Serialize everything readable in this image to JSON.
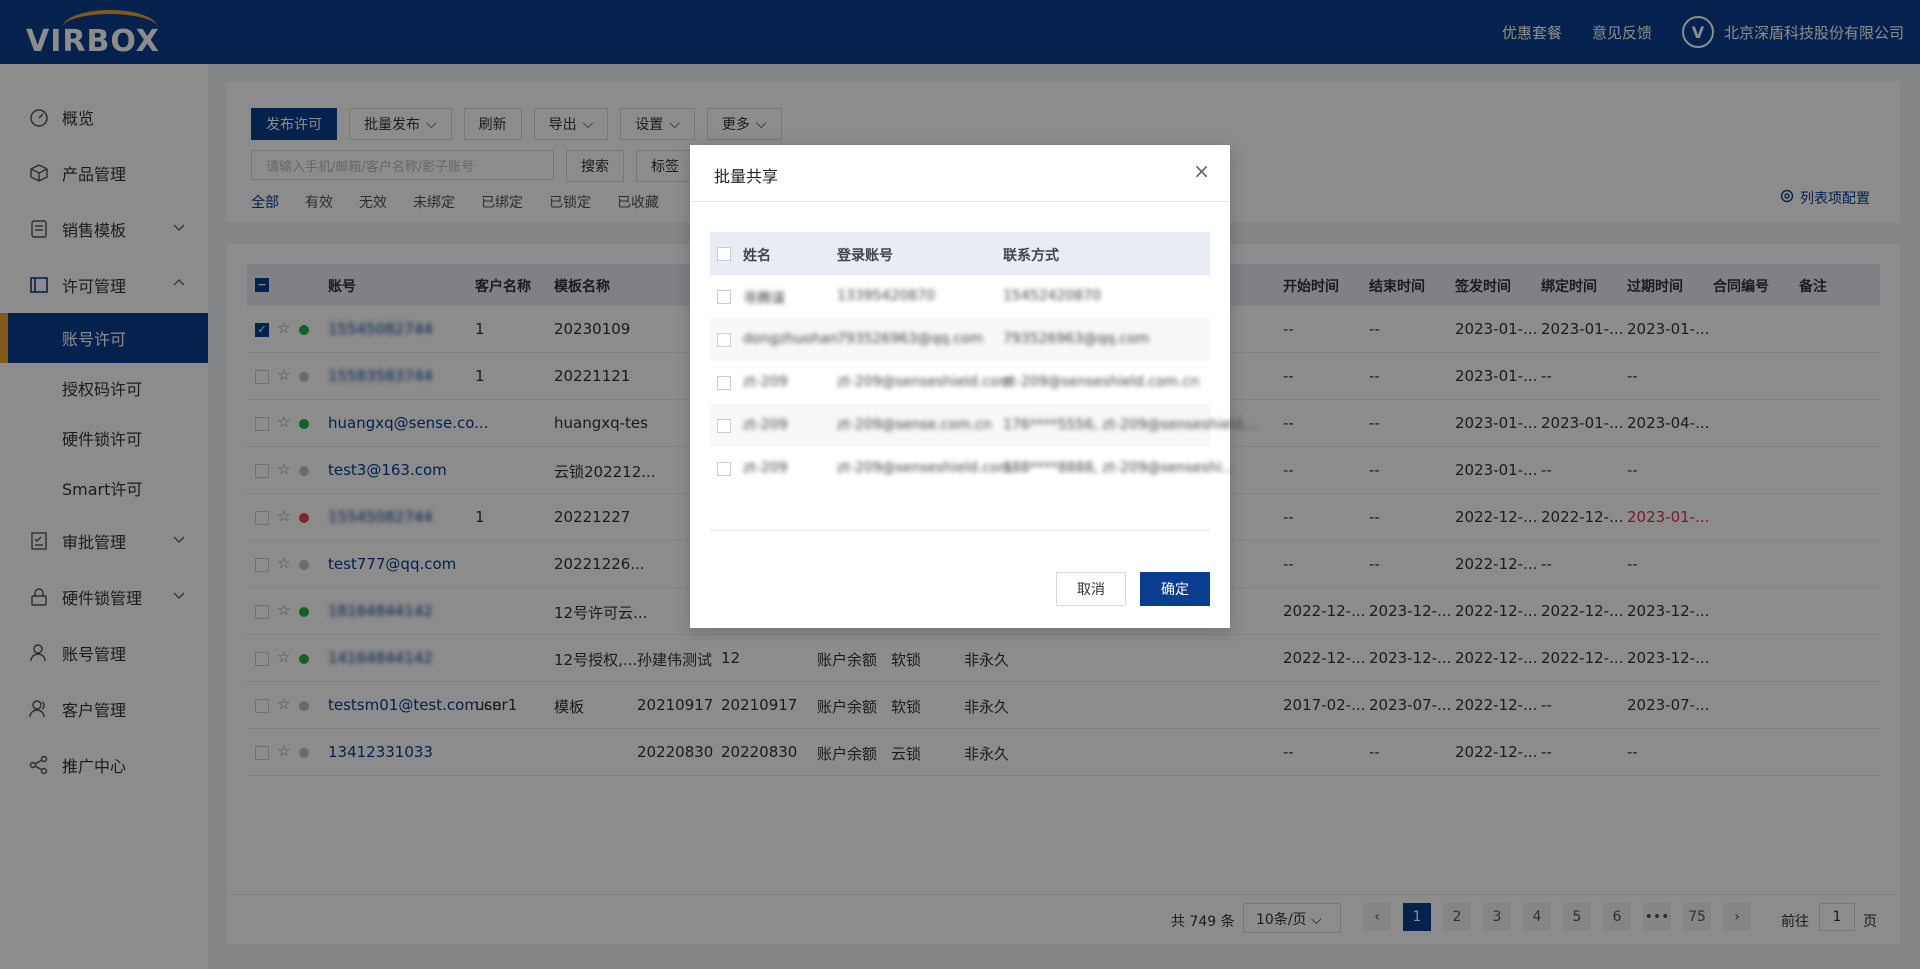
{
  "header": {
    "logo_text": "VIRBOX",
    "links": [
      "优惠套餐",
      "意见反馈"
    ],
    "company": "北京深盾科技股份有限公司"
  },
  "sidebar": {
    "items": [
      {
        "label": "概览",
        "icon": "dashboard-icon"
      },
      {
        "label": "产品管理",
        "icon": "cube-icon"
      },
      {
        "label": "销售模板",
        "icon": "template-icon",
        "chevron": "down"
      },
      {
        "label": "许可管理",
        "icon": "license-icon",
        "chevron": "up"
      },
      {
        "label": "审批管理",
        "icon": "approval-icon",
        "chevron": "down"
      },
      {
        "label": "硬件锁管理",
        "icon": "lock-icon",
        "chevron": "down"
      },
      {
        "label": "账号管理",
        "icon": "user-icon"
      },
      {
        "label": "客户管理",
        "icon": "users-icon"
      },
      {
        "label": "推广中心",
        "icon": "share-icon"
      }
    ],
    "license_sub": [
      "账号许可",
      "授权码许可",
      "硬件锁许可",
      "Smart许可"
    ],
    "active_sub": "账号许可"
  },
  "toolbar": {
    "publish": "发布许可",
    "batch_publish": "批量发布",
    "refresh": "刷新",
    "export": "导出",
    "settings": "设置",
    "more": "更多",
    "search_placeholder": "请输入手机/邮箱/客户名称/影子账号",
    "search_btn": "搜索",
    "tag_btn": "标签",
    "filters": [
      "全部",
      "有效",
      "无效",
      "未绑定",
      "已绑定",
      "已锁定",
      "已收藏"
    ],
    "column_config": "列表项配置"
  },
  "table": {
    "headers": [
      "账号",
      "客户名称",
      "模板名称",
      "开始时间",
      "结束时间",
      "签发时间",
      "绑定时间",
      "过期时间",
      "合同编号",
      "备注"
    ],
    "rows": [
      {
        "account": "15545082744",
        "blur": true,
        "checked": true,
        "status": "green",
        "customer": "1",
        "template": "20230109",
        "c4": "",
        "c5": "",
        "c6": "",
        "c7": "",
        "c8": "",
        "start": "--",
        "end": "--",
        "issue": "2023-01-...",
        "bind": "2023-01-...",
        "expire": "2023-01-..."
      },
      {
        "account": "15583583744",
        "blur": true,
        "checked": false,
        "status": "gray",
        "customer": "1",
        "template": "20221121",
        "c4": "",
        "c5": "",
        "c6": "",
        "c7": "",
        "c8": "",
        "start": "--",
        "end": "--",
        "issue": "2023-01-...",
        "bind": "--",
        "expire": "--"
      },
      {
        "account": "huangxq@sense.co...",
        "blur": false,
        "checked": false,
        "status": "green",
        "customer": "",
        "template": "huangxq-tes",
        "c4": "",
        "c5": "",
        "c6": "",
        "c7": "",
        "c8": "",
        "start": "--",
        "end": "--",
        "issue": "2023-01-...",
        "bind": "2023-01-...",
        "expire": "2023-04-..."
      },
      {
        "account": "test3@163.com",
        "blur": false,
        "checked": false,
        "status": "gray",
        "customer": "",
        "template": "云锁202212...",
        "c4": "",
        "c5": "",
        "c6": "",
        "c7": "",
        "c8": "",
        "start": "--",
        "end": "--",
        "issue": "2023-01-...",
        "bind": "--",
        "expire": "--"
      },
      {
        "account": "15545082744",
        "blur": true,
        "checked": false,
        "status": "red",
        "customer": "1",
        "template": "20221227",
        "c4": "",
        "c5": "",
        "c6": "",
        "c7": "",
        "c8": "",
        "start": "--",
        "end": "--",
        "issue": "2022-12-...",
        "bind": "2022-12-...",
        "expire": "2023-01-...",
        "expire_red": true
      },
      {
        "account": "test777@qq.com",
        "blur": false,
        "checked": false,
        "status": "gray",
        "customer": "",
        "template": "20221226...",
        "c4": "",
        "c5": "",
        "c6": "",
        "c7": "",
        "c8": "",
        "start": "--",
        "end": "--",
        "issue": "2022-12-...",
        "bind": "--",
        "expire": "--"
      },
      {
        "account": "18164844142",
        "blur": true,
        "checked": false,
        "status": "green",
        "customer": "",
        "template": "12号许可云...",
        "c4": "",
        "c5": "",
        "c6": "",
        "c7": "",
        "c8": "",
        "start": "2022-12-...",
        "end": "2023-12-...",
        "issue": "2022-12-...",
        "bind": "2022-12-...",
        "expire": "2023-12-..."
      },
      {
        "account": "14164844142",
        "blur": true,
        "checked": false,
        "status": "green",
        "customer": "",
        "template": "12号授权,...",
        "c4": "孙建伟测试",
        "c5": "12",
        "c6": "账户余额",
        "c7": "软锁",
        "c8": "非永久",
        "start": "2022-12-...",
        "end": "2023-12-...",
        "issue": "2022-12-...",
        "bind": "2022-12-...",
        "expire": "2023-12-..."
      },
      {
        "account": "testsm01@test.com.cn",
        "blur": false,
        "checked": false,
        "status": "gray",
        "customer": "user1",
        "template": "模板",
        "c4": "20210917",
        "c5": "20210917",
        "c6": "账户余额",
        "c7": "软锁",
        "c8": "非永久",
        "start": "2017-02-...",
        "end": "2023-07-...",
        "issue": "2022-12-...",
        "bind": "--",
        "expire": "2023-07-..."
      },
      {
        "account": "13412331033",
        "blur": false,
        "checked": false,
        "status": "gray",
        "customer": "",
        "template": "",
        "c4": "20220830",
        "c5": "20220830",
        "c6": "账户余额",
        "c7": "云锁",
        "c8": "非永久",
        "start": "--",
        "end": "--",
        "issue": "2022-12-...",
        "bind": "--",
        "expire": "--"
      }
    ]
  },
  "pagination": {
    "total": "共 749 条",
    "page_size": "10条/页",
    "pages": [
      "1",
      "2",
      "3",
      "4",
      "5",
      "6",
      "•••",
      "75"
    ],
    "current": "1",
    "goto_label": "前往",
    "goto_value": "1",
    "page_suffix": "页"
  },
  "modal": {
    "title": "批量共享",
    "headers": [
      "姓名",
      "登录账号",
      "联系方式"
    ],
    "rows": [
      {
        "name": "寻腾谋",
        "login": "13395420870",
        "contact": "15452420870"
      },
      {
        "name": "dongzhuohan",
        "login": "793526963@qq.com",
        "contact": "793526963@qq.com"
      },
      {
        "name": "zt-209",
        "login": "zt-209@senseshield.com",
        "contact": "zt-209@senseshield.com.cn"
      },
      {
        "name": "zt-209",
        "login": "zt-209@sense.com.cn",
        "contact": "176****5556, zt-209@senseshield..."
      },
      {
        "name": "zt-209",
        "login": "zt-209@senseshield.com",
        "contact": "188****8888, zt-209@senseshi..."
      }
    ],
    "cancel": "取消",
    "ok": "确定"
  },
  "colors": {
    "brand": "#0a3d8f",
    "accent": "#f0a030",
    "status_green": "#22b14c",
    "status_red": "#e5484d",
    "status_gray": "#c2c2c2"
  }
}
